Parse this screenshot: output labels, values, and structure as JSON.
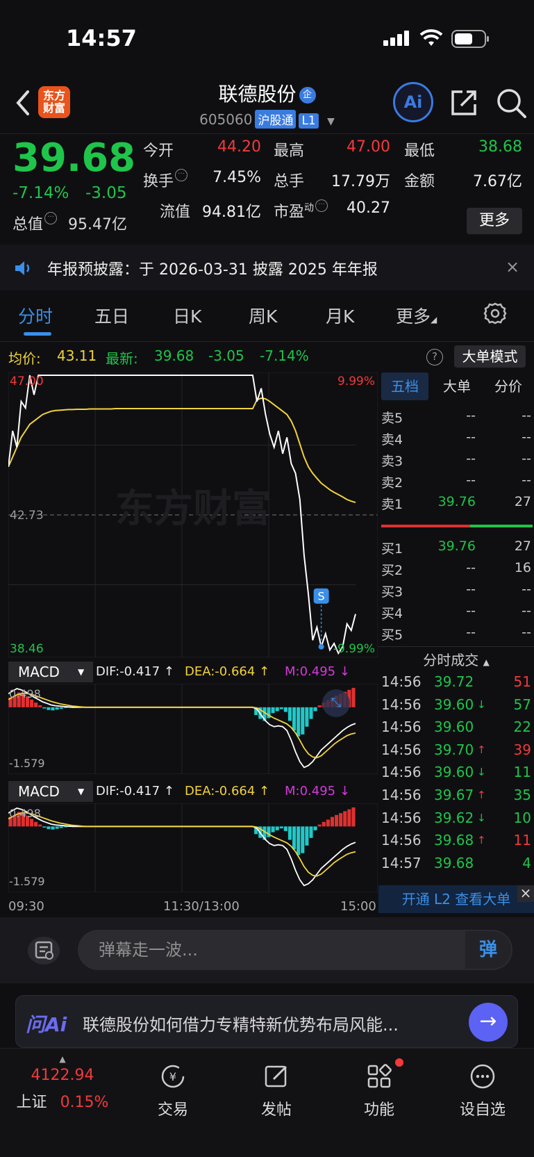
{
  "status_bar": {
    "time": "14:57"
  },
  "header": {
    "logo_line1": "东方",
    "logo_line2": "财富",
    "stock_name": "联德股份",
    "badge": "企",
    "code": "605060",
    "market_tag": "沪股通",
    "level_tag": "L1",
    "ai_label": "Ai"
  },
  "quote": {
    "price": "39.68",
    "change_pct": "-7.14%",
    "change_amt": "-3.05",
    "open_label": "今开",
    "open": "44.20",
    "high_label": "最高",
    "high": "47.00",
    "low_label": "最低",
    "low": "38.68",
    "turnover_label": "换手",
    "turnover": "7.45%",
    "volume_label": "总手",
    "volume": "17.79万",
    "amount_label": "金额",
    "amount": "7.67亿",
    "mktcap_label": "总值",
    "mktcap": "95.47亿",
    "float_label": "流值",
    "float_cap": "94.81亿",
    "pe_label": "市盈",
    "pe_sup": "动",
    "pe": "40.27",
    "more_label": "更多"
  },
  "announcement": {
    "text": "年报预披露：于 2026-03-31 披露 2025 年年报",
    "close": "×"
  },
  "tabs": [
    {
      "label": "分时"
    },
    {
      "label": "五日"
    },
    {
      "label": "日K"
    },
    {
      "label": "周K"
    },
    {
      "label": "月K"
    },
    {
      "label": "更多"
    }
  ],
  "avg_line": {
    "avg_label": "均价:",
    "avg": "43.11",
    "latest_label": "最新:",
    "latest": "39.68",
    "chg": "-3.05",
    "pct": "-7.14%",
    "help": "?",
    "big_order_mode": "大单模式"
  },
  "chart_data": {
    "type": "line",
    "y_max_label": "47.00",
    "y_max_pct": "9.99%",
    "y_mid_label": "42.73",
    "y_min_label": "38.46",
    "y_min_pct": "-9.99%",
    "ylim": [
      38.46,
      47.0
    ],
    "prev_close": 42.73,
    "watermark": "东方财富",
    "signal_marker": "S",
    "series": [
      {
        "name": "price",
        "color": "#ffffff",
        "values": [
          44.2,
          45.3,
          44.8,
          46.2,
          46.0,
          47.0,
          46.4,
          47.0,
          47.0,
          47.0,
          47.0,
          47.0,
          47.0,
          47.0,
          47.0,
          47.0,
          47.0,
          47.0,
          47.0,
          47.0,
          47.0,
          47.0,
          47.0,
          47.0,
          47.0,
          47.0,
          47.0,
          47.0,
          47.0,
          47.0,
          47.0,
          47.0,
          47.0,
          47.0,
          47.0,
          47.0,
          47.0,
          47.0,
          47.0,
          47.0,
          47.0,
          47.0,
          47.0,
          47.0,
          47.0,
          47.0,
          47.0,
          47.0,
          47.0,
          47.0,
          47.0,
          47.0,
          47.0,
          47.0,
          47.0,
          47.0,
          47.0,
          47.0,
          46.2,
          46.6,
          45.8,
          45.2,
          44.8,
          45.3,
          44.6,
          45.1,
          44.3,
          44.0,
          43.2,
          41.5,
          40.3,
          38.9,
          39.3,
          38.7,
          39.1,
          38.6,
          38.8,
          38.5,
          38.7,
          39.4,
          39.2,
          39.7
        ]
      },
      {
        "name": "avg",
        "color": "#f2d33d",
        "values": [
          44.2,
          44.5,
          44.8,
          45.1,
          45.3,
          45.5,
          45.6,
          45.7,
          45.8,
          45.85,
          45.9,
          45.92,
          45.93,
          45.94,
          45.95,
          45.95,
          45.96,
          45.96,
          45.96,
          45.97,
          45.97,
          45.97,
          45.97,
          45.97,
          45.97,
          45.98,
          45.98,
          45.98,
          45.98,
          45.98,
          45.98,
          45.98,
          45.98,
          45.98,
          45.98,
          45.98,
          45.98,
          45.98,
          45.98,
          45.98,
          45.98,
          45.98,
          45.98,
          45.98,
          45.98,
          45.98,
          45.98,
          45.98,
          45.98,
          45.98,
          45.98,
          45.98,
          45.98,
          45.98,
          45.98,
          45.98,
          45.98,
          45.98,
          46.25,
          46.3,
          46.28,
          46.2,
          46.1,
          46.0,
          45.9,
          45.8,
          45.6,
          45.3,
          44.9,
          44.5,
          44.2,
          44.0,
          43.85,
          43.7,
          43.6,
          43.5,
          43.42,
          43.35,
          43.28,
          43.2,
          43.15,
          43.11
        ]
      }
    ],
    "x_ticks": [
      "09:30",
      "11:30/13:00",
      "15:00"
    ]
  },
  "macd": {
    "selector": "MACD",
    "dif": "DIF:-0.417 ↑",
    "dea": "DEA:-0.664 ↑",
    "m": "M:0.495 ↓",
    "top_label": "0.498",
    "bottom_label": "-1.579",
    "hist": [
      0.25,
      0.3,
      0.38,
      0.35,
      0.28,
      0.2,
      0.12,
      0.05,
      -0.03,
      -0.07,
      -0.08,
      -0.06,
      -0.04,
      -0.02,
      -0.01,
      0,
      0,
      0,
      0,
      0,
      0,
      0,
      0,
      0,
      0,
      0,
      0,
      0,
      0,
      0,
      0,
      0,
      0,
      0,
      0,
      0,
      0,
      0,
      0,
      0,
      0,
      0,
      0,
      0,
      0,
      0,
      0,
      0,
      0,
      0,
      0,
      0,
      0,
      0,
      0,
      0,
      0,
      0,
      -0.2,
      -0.3,
      -0.35,
      -0.28,
      -0.15,
      -0.1,
      -0.05,
      -0.12,
      -0.35,
      -0.6,
      -0.75,
      -0.7,
      -0.5,
      -0.3,
      -0.1,
      0.05,
      0.12,
      0.18,
      0.25,
      0.3,
      0.35,
      0.4,
      0.45,
      0.5
    ],
    "dif_line": [
      0.35,
      0.42,
      0.48,
      0.45,
      0.4,
      0.33,
      0.26,
      0.2,
      0.14,
      0.1,
      0.06,
      0.04,
      0.03,
      0.02,
      0.01,
      0,
      0,
      0,
      0,
      0,
      0,
      0,
      0,
      0,
      0,
      0,
      0,
      0,
      0,
      0,
      0,
      0,
      0,
      0,
      0,
      0,
      0,
      0,
      0,
      0,
      0,
      0,
      0,
      0,
      0,
      0,
      0,
      0,
      0,
      0,
      0,
      0,
      0,
      0,
      0,
      0,
      0,
      0,
      -0.05,
      -0.2,
      -0.35,
      -0.45,
      -0.5,
      -0.48,
      -0.5,
      -0.6,
      -0.85,
      -1.15,
      -1.4,
      -1.55,
      -1.5,
      -1.4,
      -1.25,
      -1.1,
      -1.0,
      -0.9,
      -0.8,
      -0.7,
      -0.6,
      -0.52,
      -0.46,
      -0.417
    ],
    "dea_line": [
      0.2,
      0.26,
      0.32,
      0.35,
      0.36,
      0.34,
      0.31,
      0.27,
      0.23,
      0.19,
      0.15,
      0.12,
      0.09,
      0.07,
      0.05,
      0.03,
      0.02,
      0.01,
      0,
      0,
      0,
      0,
      0,
      0,
      0,
      0,
      0,
      0,
      0,
      0,
      0,
      0,
      0,
      0,
      0,
      0,
      0,
      0,
      0,
      0,
      0,
      0,
      0,
      0,
      0,
      0,
      0,
      0,
      0,
      0,
      0,
      0,
      0,
      0,
      0,
      0,
      0,
      0,
      -0.02,
      -0.08,
      -0.15,
      -0.22,
      -0.28,
      -0.33,
      -0.38,
      -0.43,
      -0.52,
      -0.66,
      -0.85,
      -1.05,
      -1.2,
      -1.28,
      -1.3,
      -1.25,
      -1.15,
      -1.05,
      -0.95,
      -0.87,
      -0.8,
      -0.73,
      -0.69,
      -0.664
    ]
  },
  "right_panel": {
    "tabs": [
      "五档",
      "大单",
      "分价"
    ],
    "sell": [
      {
        "label": "卖5",
        "price": "--",
        "vol": "--"
      },
      {
        "label": "卖4",
        "price": "--",
        "vol": "--"
      },
      {
        "label": "卖3",
        "price": "--",
        "vol": "--"
      },
      {
        "label": "卖2",
        "price": "--",
        "vol": "--"
      },
      {
        "label": "卖1",
        "price": "39.76",
        "vol": "27"
      }
    ],
    "buy": [
      {
        "label": "买1",
        "price": "39.76",
        "vol": "27"
      },
      {
        "label": "买2",
        "price": "--",
        "vol": "16"
      },
      {
        "label": "买3",
        "price": "--",
        "vol": "--"
      },
      {
        "label": "买4",
        "price": "--",
        "vol": "--"
      },
      {
        "label": "买5",
        "price": "--",
        "vol": "--"
      }
    ],
    "trades_title": "分时成交",
    "trades": [
      {
        "time": "14:56",
        "price": "39.72",
        "arrow": "",
        "vol": "51",
        "pc": "green",
        "vc": "red"
      },
      {
        "time": "14:56",
        "price": "39.60",
        "arrow": "↓",
        "vol": "57",
        "pc": "green",
        "vc": "green"
      },
      {
        "time": "14:56",
        "price": "39.60",
        "arrow": "",
        "vol": "22",
        "pc": "green",
        "vc": "green"
      },
      {
        "time": "14:56",
        "price": "39.70",
        "arrow": "↑",
        "vol": "39",
        "pc": "green",
        "vc": "red"
      },
      {
        "time": "14:56",
        "price": "39.60",
        "arrow": "↓",
        "vol": "11",
        "pc": "green",
        "vc": "green"
      },
      {
        "time": "14:56",
        "price": "39.67",
        "arrow": "↑",
        "vol": "35",
        "pc": "green",
        "vc": "green"
      },
      {
        "time": "14:56",
        "price": "39.62",
        "arrow": "↓",
        "vol": "10",
        "pc": "green",
        "vc": "green"
      },
      {
        "time": "14:56",
        "price": "39.68",
        "arrow": "↑",
        "vol": "11",
        "pc": "green",
        "vc": "red"
      },
      {
        "time": "14:57",
        "price": "39.68",
        "arrow": "",
        "vol": "4",
        "pc": "green",
        "vc": "green"
      }
    ],
    "l2_banner": "开通 L2 查看大单",
    "l2_close": "×"
  },
  "danmaku": {
    "placeholder": "弹幕走一波...",
    "send": "弹"
  },
  "ask_ai": {
    "logo": "问Ai",
    "text": "联德股份如何借力专精特新优势布局风能...",
    "go": "→"
  },
  "bottom_nav": {
    "index_value": "4122.94",
    "index_name": "上证",
    "index_pct": "0.15%",
    "trade": "交易",
    "post": "发帖",
    "features": "功能",
    "watchlist": "设自选"
  },
  "colors": {
    "up": "#f23a3a",
    "down": "#1fc54a",
    "accent": "#3a8fe8",
    "avg_line": "#f2d33d"
  }
}
